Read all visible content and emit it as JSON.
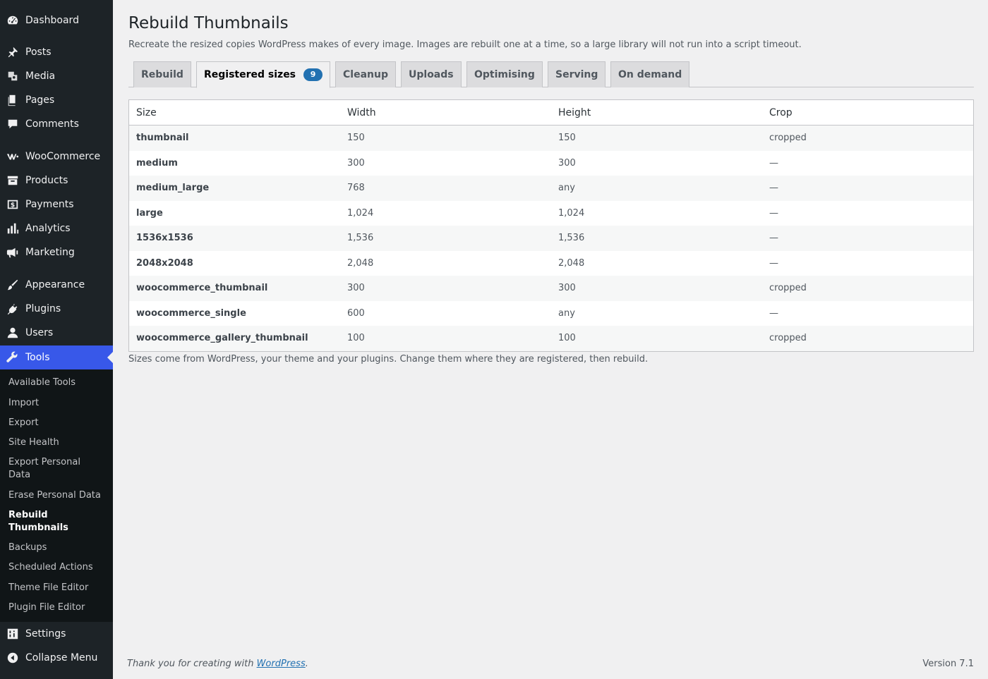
{
  "sidebar": {
    "items": [
      {
        "label": "Dashboard",
        "icon": "dashboard-icon"
      },
      {
        "label": "Posts",
        "icon": "pin-icon"
      },
      {
        "label": "Media",
        "icon": "media-icon"
      },
      {
        "label": "Pages",
        "icon": "pages-icon"
      },
      {
        "label": "Comments",
        "icon": "comment-icon"
      },
      {
        "label": "WooCommerce",
        "icon": "woocommerce-icon"
      },
      {
        "label": "Products",
        "icon": "archive-icon"
      },
      {
        "label": "Payments",
        "icon": "dollar-icon"
      },
      {
        "label": "Analytics",
        "icon": "bar-chart-icon"
      },
      {
        "label": "Marketing",
        "icon": "megaphone-icon"
      },
      {
        "label": "Appearance",
        "icon": "paintbrush-icon"
      },
      {
        "label": "Plugins",
        "icon": "plug-icon"
      },
      {
        "label": "Users",
        "icon": "user-icon"
      },
      {
        "label": "Tools",
        "icon": "wrench-icon"
      },
      {
        "label": "Settings",
        "icon": "sliders-icon"
      },
      {
        "label": "Collapse Menu",
        "icon": "collapse-arrow-icon"
      }
    ],
    "submenu": [
      "Available Tools",
      "Import",
      "Export",
      "Site Health",
      "Export Personal Data",
      "Erase Personal Data",
      "Rebuild Thumbnails",
      "Backups",
      "Scheduled Actions",
      "Theme File Editor",
      "Plugin File Editor"
    ]
  },
  "page": {
    "title": "Rebuild Thumbnails",
    "description": "Recreate the resized copies WordPress makes of every image. Images are rebuilt one at a time, so a large library will not run into a script timeout.",
    "tabs": [
      {
        "label": "Rebuild"
      },
      {
        "label": "Registered sizes",
        "badge": "9"
      },
      {
        "label": "Cleanup"
      },
      {
        "label": "Uploads"
      },
      {
        "label": "Optimising"
      },
      {
        "label": "Serving"
      },
      {
        "label": "On demand"
      }
    ],
    "table": {
      "headers": [
        "Size",
        "Width",
        "Height",
        "Crop"
      ],
      "rows": [
        [
          "thumbnail",
          "150",
          "150",
          "cropped"
        ],
        [
          "medium",
          "300",
          "300",
          "—"
        ],
        [
          "medium_large",
          "768",
          "any",
          "—"
        ],
        [
          "large",
          "1,024",
          "1,024",
          "—"
        ],
        [
          "1536x1536",
          "1,536",
          "1,536",
          "—"
        ],
        [
          "2048x2048",
          "2,048",
          "2,048",
          "—"
        ],
        [
          "woocommerce_thumbnail",
          "300",
          "300",
          "cropped"
        ],
        [
          "woocommerce_single",
          "600",
          "any",
          "—"
        ],
        [
          "woocommerce_gallery_thumbnail",
          "100",
          "100",
          "cropped"
        ]
      ]
    },
    "note": "Sizes come from WordPress, your theme and your plugins. Change them where they are registered, then rebuild."
  },
  "footer": {
    "thanks_prefix": "Thank you for creating with ",
    "thanks_link": "WordPress",
    "thanks_suffix": ".",
    "version": "Version 7.1"
  },
  "colors": {
    "sidebar_bg": "#1d2327",
    "submenu_bg": "#101517",
    "accent": "#3858e9",
    "badge": "#2271b1"
  }
}
